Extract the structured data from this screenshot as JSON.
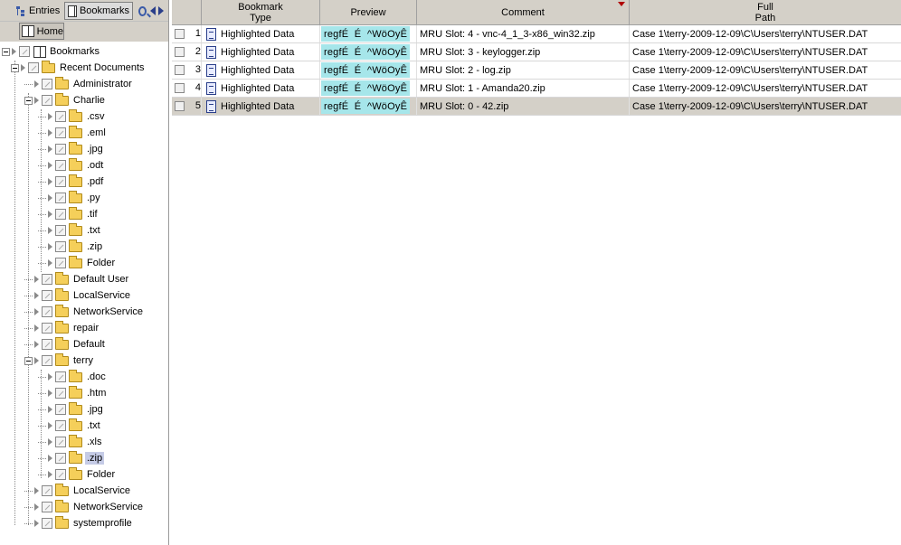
{
  "toolbar": {
    "entries_label": "Entries",
    "bookmarks_label": "Bookmarks",
    "home_label": "Home"
  },
  "tree": {
    "root": "Bookmarks",
    "recent": "Recent Documents",
    "administrator": "Administrator",
    "charlie": "Charlie",
    "charlie_children": [
      ".csv",
      ".eml",
      ".jpg",
      ".odt",
      ".pdf",
      ".py",
      ".tif",
      ".txt",
      ".zip",
      "Folder"
    ],
    "default_user": "Default User",
    "local_service_1": "LocalService",
    "network_service_1": "NetworkService",
    "repair": "repair",
    "default": "Default",
    "terry": "terry",
    "terry_children": [
      ".doc",
      ".htm",
      ".jpg",
      ".txt",
      ".xls",
      ".zip",
      "Folder"
    ],
    "local_service_2": "LocalService",
    "network_service_2": "NetworkService",
    "systemprofile": "systemprofile"
  },
  "grid": {
    "headers": {
      "bookmark_type": "Bookmark Type",
      "preview": "Preview",
      "comment": "Comment",
      "full_path": "Full Path"
    },
    "rows": [
      {
        "num": "1",
        "type": "Highlighted Data",
        "preview": "regfÉ  É  ^WöOyÊ",
        "comment": "MRU Slot: 4 - vnc-4_1_3-x86_win32.zip",
        "path": "Case 1\\terry-2009-12-09\\C\\Users\\terry\\NTUSER.DAT"
      },
      {
        "num": "2",
        "type": "Highlighted Data",
        "preview": "regfÉ  É  ^WöOyÊ",
        "comment": "MRU Slot: 3 - keylogger.zip",
        "path": "Case 1\\terry-2009-12-09\\C\\Users\\terry\\NTUSER.DAT"
      },
      {
        "num": "3",
        "type": "Highlighted Data",
        "preview": "regfÉ  É  ^WöOyÊ",
        "comment": "MRU Slot: 2 - log.zip",
        "path": "Case 1\\terry-2009-12-09\\C\\Users\\terry\\NTUSER.DAT"
      },
      {
        "num": "4",
        "type": "Highlighted Data",
        "preview": "regfÉ  É  ^WöOyÊ",
        "comment": "MRU Slot: 1 - Amanda20.zip",
        "path": "Case 1\\terry-2009-12-09\\C\\Users\\terry\\NTUSER.DAT"
      },
      {
        "num": "5",
        "type": "Highlighted Data",
        "preview": "regfÉ  É  ^WöOyÊ",
        "comment": "MRU Slot: 0 - 42.zip",
        "path": "Case 1\\terry-2009-12-09\\C\\Users\\terry\\NTUSER.DAT"
      }
    ],
    "selected_row": 5
  },
  "colors": {
    "preview_highlight": "#a6e6ea",
    "chrome": "#d4d0c8",
    "sort_indicator": "#b00000",
    "folder": "#f5cf5a"
  }
}
